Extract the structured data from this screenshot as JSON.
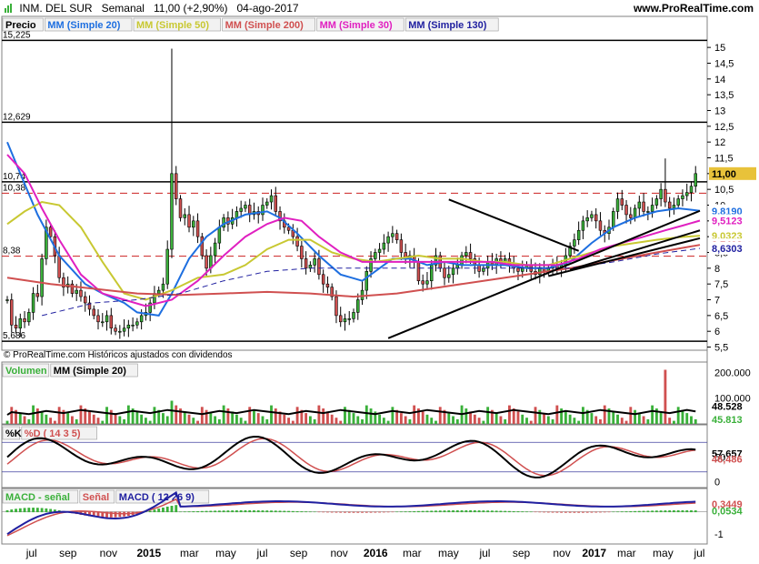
{
  "header": {
    "instrument": "INM. DEL SUR",
    "period": "Semanal",
    "last_change": "11,00 (+2,90%)",
    "date": "04-ago-2017",
    "site": "www.ProRealTime.com"
  },
  "price_panel": {
    "legend": [
      {
        "label": "Precio",
        "color": "#000000"
      },
      {
        "label": "MM (Simple 20)",
        "color": "#1e6fe0"
      },
      {
        "label": "MM (Simple 50)",
        "color": "#c8c832"
      },
      {
        "label": "MM (Simple 200)",
        "color": "#d05050"
      },
      {
        "label": "MM (Simple 30)",
        "color": "#e020c0"
      },
      {
        "label": "MM (Simple 130)",
        "color": "#2020a0"
      }
    ],
    "copyright": "© ProRealTime.com  Históricos ajustados con dividendos",
    "hlines": [
      {
        "label": "15,225",
        "value": 15.225,
        "style": "solid"
      },
      {
        "label": "12,629",
        "value": 12.629,
        "style": "solid"
      },
      {
        "label": "10,74",
        "value": 10.74,
        "style": "solid"
      },
      {
        "label": "10,38",
        "value": 10.38,
        "style": "dashed"
      },
      {
        "label": "8,38",
        "value": 8.38,
        "style": "dashed"
      },
      {
        "label": "5,686",
        "value": 5.686,
        "style": "solid"
      }
    ],
    "badges": [
      {
        "text": "11,00",
        "value": 11.0,
        "bg": "#e8c23a",
        "fg": "#000000"
      },
      {
        "text": "9,8190",
        "value": 9.819,
        "bg": "#ffffff",
        "fg": "#1e6fe0"
      },
      {
        "text": "9,5123",
        "value": 9.5123,
        "bg": "#ffffff",
        "fg": "#e020c0"
      },
      {
        "text": "9,0323",
        "value": 9.0323,
        "bg": "#ffffff",
        "fg": "#c8c832"
      },
      {
        "text": "8,7408",
        "value": 8.7408,
        "bg": "#ffffff",
        "fg": "#d05050"
      },
      {
        "text": "8,6303",
        "value": 8.6303,
        "bg": "#ffffff",
        "fg": "#2020a0"
      }
    ]
  },
  "volume_panel": {
    "legend": [
      {
        "label": "Volumen",
        "color": "#3ab03a"
      },
      {
        "label": "MM (Simple 20)",
        "color": "#000000"
      }
    ],
    "ticks": [
      "200.000",
      "100.000"
    ],
    "badges": [
      {
        "text": "48.528",
        "value": 48528,
        "fg": "#000000"
      },
      {
        "text": "45.813",
        "value": 45813,
        "fg": "#3ab03a"
      }
    ]
  },
  "stoch_panel": {
    "legend": [
      {
        "label": "%K",
        "color": "#000000"
      },
      {
        "label": "%D ( 14 3 5)",
        "color": "#d05050"
      }
    ],
    "ticks": [
      "50",
      "0"
    ],
    "badges": [
      {
        "text": "57,657",
        "value": 57.657,
        "fg": "#000000"
      },
      {
        "text": "46,486",
        "value": 46.486,
        "fg": "#d05050"
      }
    ]
  },
  "macd_panel": {
    "legend": [
      {
        "label": "MACD - señal",
        "color": "#3ab03a"
      },
      {
        "label": "Señal",
        "color": "#d05050"
      },
      {
        "label": "MACD ( 12 26 9)",
        "color": "#2020a0"
      }
    ],
    "ticks": [
      "-1"
    ],
    "badges": [
      {
        "text": "0,3449",
        "value": 0.3449,
        "fg": "#d05050"
      },
      {
        "text": "0,0534",
        "value": 0.0534,
        "fg": "#3ab03a"
      }
    ]
  },
  "x_labels": [
    "jul",
    "sep",
    "nov",
    "2015",
    "mar",
    "may",
    "jul",
    "sep",
    "nov",
    "2016",
    "mar",
    "may",
    "jul",
    "sep",
    "nov",
    "2017",
    "mar",
    "may",
    "jul"
  ],
  "chart_data": {
    "type": "line",
    "price_axis": {
      "ticks": [
        "5,5",
        "6",
        "6,5",
        "7",
        "7,5",
        "8",
        "8,5",
        "9",
        "9,5",
        "10",
        "10,5",
        "11",
        "11,5",
        "12",
        "12,5",
        "13",
        "13,5",
        "14",
        "14,5",
        "15"
      ],
      "ylim": [
        5.4,
        15.35
      ]
    },
    "x_range": [
      0,
      160
    ],
    "x_label_positions": [
      6,
      15,
      25,
      35,
      45,
      54,
      63,
      72,
      82,
      91,
      100,
      109,
      118,
      127,
      137,
      145,
      153,
      162,
      171
    ],
    "price_closes": [
      7.0,
      6.2,
      6.1,
      6.4,
      6.3,
      6.6,
      7.2,
      7.1,
      8.3,
      9.3,
      9.0,
      8.4,
      7.7,
      7.4,
      7.5,
      7.2,
      7.3,
      7.1,
      6.9,
      6.7,
      6.5,
      6.3,
      6.3,
      6.5,
      6.1,
      6.0,
      6.0,
      6.1,
      6.2,
      6.2,
      6.3,
      6.5,
      6.6,
      6.9,
      7.2,
      7.3,
      7.5,
      8.6,
      11.0,
      10.2,
      9.6,
      9.7,
      9.3,
      9.5,
      9.0,
      8.4,
      8.0,
      8.4,
      8.8,
      9.3,
      9.6,
      9.4,
      9.6,
      9.8,
      9.9,
      10.0,
      9.7,
      9.8,
      9.7,
      10.0,
      10.1,
      10.3,
      9.8,
      9.5,
      9.3,
      9.2,
      9.0,
      8.7,
      8.3,
      8.0,
      8.1,
      8.3,
      7.8,
      7.5,
      7.4,
      7.1,
      6.5,
      6.3,
      6.4,
      6.4,
      6.6,
      7.0,
      7.3,
      7.9,
      8.3,
      8.5,
      8.6,
      8.8,
      9.0,
      9.1,
      8.9,
      8.5,
      8.3,
      8.4,
      8.2,
      7.6,
      7.5,
      7.6,
      8.1,
      8.4,
      8.0,
      7.7,
      7.8,
      8.0,
      8.1,
      8.4,
      8.5,
      8.3,
      8.1,
      7.9,
      8.0,
      8.2,
      8.1,
      8.3,
      8.2,
      8.3,
      8.1,
      8.0,
      7.9,
      8.0,
      8.1,
      7.9,
      7.8,
      8.0,
      7.9,
      8.0,
      8.1,
      8.0,
      8.1,
      8.4,
      8.7,
      8.9,
      9.2,
      9.5,
      9.6,
      9.7,
      9.5,
      9.2,
      9.1,
      9.3,
      9.8,
      10.2,
      10.0,
      9.7,
      9.6,
      9.9,
      10.1,
      9.8,
      9.8,
      10.0,
      10.2,
      10.5,
      10.1,
      9.9,
      10.0,
      10.2,
      10.3,
      10.4,
      10.6,
      11.0
    ],
    "series": [
      {
        "name": "MM (Simple 20)",
        "color": "#1e6fe0",
        "values": [
          [
            0,
            12.0
          ],
          [
            3,
            11.0
          ],
          [
            7,
            9.7
          ],
          [
            12,
            8.4
          ],
          [
            18,
            7.5
          ],
          [
            22,
            7.2
          ],
          [
            27,
            6.9
          ],
          [
            30,
            6.6
          ],
          [
            35,
            6.5
          ],
          [
            38,
            7.2
          ],
          [
            42,
            8.3
          ],
          [
            46,
            9.0
          ],
          [
            50,
            9.4
          ],
          [
            55,
            9.7
          ],
          [
            60,
            9.8
          ],
          [
            63,
            9.6
          ],
          [
            67,
            9.1
          ],
          [
            72,
            8.4
          ],
          [
            77,
            7.8
          ],
          [
            82,
            7.6
          ],
          [
            85,
            7.9
          ],
          [
            89,
            8.3
          ],
          [
            93,
            8.3
          ],
          [
            97,
            8.1
          ],
          [
            101,
            8.2
          ],
          [
            105,
            8.1
          ],
          [
            110,
            8.1
          ],
          [
            115,
            8.1
          ],
          [
            120,
            8.0
          ],
          [
            125,
            8.0
          ],
          [
            130,
            8.2
          ],
          [
            135,
            8.8
          ],
          [
            140,
            9.3
          ],
          [
            145,
            9.6
          ],
          [
            150,
            9.8
          ],
          [
            155,
            9.9
          ],
          [
            160,
            9.82
          ]
        ]
      },
      {
        "name": "MM (Simple 50)",
        "color": "#c8c832",
        "values": [
          [
            0,
            9.4
          ],
          [
            4,
            9.8
          ],
          [
            8,
            10.1
          ],
          [
            12,
            10.0
          ],
          [
            17,
            9.3
          ],
          [
            22,
            8.2
          ],
          [
            27,
            7.2
          ],
          [
            32,
            7.0
          ],
          [
            38,
            7.3
          ],
          [
            44,
            7.7
          ],
          [
            50,
            7.8
          ],
          [
            55,
            8.1
          ],
          [
            60,
            8.6
          ],
          [
            65,
            8.9
          ],
          [
            70,
            8.9
          ],
          [
            75,
            8.5
          ],
          [
            80,
            8.3
          ],
          [
            85,
            8.2
          ],
          [
            90,
            8.3
          ],
          [
            95,
            8.4
          ],
          [
            100,
            8.3
          ],
          [
            105,
            8.3
          ],
          [
            110,
            8.2
          ],
          [
            115,
            8.2
          ],
          [
            120,
            8.1
          ],
          [
            125,
            8.1
          ],
          [
            130,
            8.3
          ],
          [
            135,
            8.5
          ],
          [
            140,
            8.7
          ],
          [
            145,
            8.8
          ],
          [
            150,
            8.9
          ],
          [
            155,
            8.98
          ],
          [
            160,
            9.03
          ]
        ]
      },
      {
        "name": "MM (Simple 30)",
        "color": "#e020c0",
        "values": [
          [
            0,
            11.6
          ],
          [
            4,
            11.0
          ],
          [
            8,
            9.9
          ],
          [
            12,
            8.9
          ],
          [
            17,
            7.8
          ],
          [
            22,
            7.2
          ],
          [
            27,
            7.0
          ],
          [
            32,
            6.8
          ],
          [
            38,
            7.0
          ],
          [
            44,
            7.6
          ],
          [
            50,
            8.4
          ],
          [
            55,
            9.0
          ],
          [
            60,
            9.4
          ],
          [
            64,
            9.6
          ],
          [
            68,
            9.5
          ],
          [
            72,
            9.0
          ],
          [
            77,
            8.5
          ],
          [
            82,
            8.2
          ],
          [
            87,
            8.2
          ],
          [
            92,
            8.2
          ],
          [
            97,
            8.2
          ],
          [
            102,
            8.2
          ],
          [
            107,
            8.2
          ],
          [
            112,
            8.2
          ],
          [
            117,
            8.1
          ],
          [
            122,
            8.1
          ],
          [
            127,
            8.1
          ],
          [
            132,
            8.3
          ],
          [
            137,
            8.6
          ],
          [
            142,
            8.8
          ],
          [
            147,
            9.0
          ],
          [
            152,
            9.2
          ],
          [
            156,
            9.35
          ],
          [
            160,
            9.51
          ]
        ]
      },
      {
        "name": "MM (Simple 200)",
        "color": "#d05050",
        "values": [
          [
            0,
            7.7
          ],
          [
            10,
            7.5
          ],
          [
            20,
            7.35
          ],
          [
            30,
            7.2
          ],
          [
            40,
            7.15
          ],
          [
            50,
            7.2
          ],
          [
            60,
            7.25
          ],
          [
            70,
            7.2
          ],
          [
            80,
            7.1
          ],
          [
            90,
            7.2
          ],
          [
            100,
            7.4
          ],
          [
            110,
            7.6
          ],
          [
            120,
            7.8
          ],
          [
            130,
            8.0
          ],
          [
            140,
            8.25
          ],
          [
            150,
            8.5
          ],
          [
            160,
            8.74
          ]
        ]
      },
      {
        "name": "MM (Simple 130)",
        "color": "#2020a0",
        "values": [
          [
            8,
            6.5
          ],
          [
            20,
            6.9
          ],
          [
            30,
            7.0
          ],
          [
            40,
            7.2
          ],
          [
            50,
            7.6
          ],
          [
            60,
            7.9
          ],
          [
            70,
            8.0
          ],
          [
            80,
            8.0
          ],
          [
            90,
            8.0
          ],
          [
            100,
            8.0
          ],
          [
            110,
            8.0
          ],
          [
            120,
            8.0
          ],
          [
            130,
            8.0
          ],
          [
            140,
            8.2
          ],
          [
            150,
            8.45
          ],
          [
            160,
            8.63
          ]
        ]
      }
    ],
    "trendlines": [
      {
        "from": [
          88,
          5.78
        ],
        "to": [
          160,
          9.82
        ]
      },
      {
        "from": [
          102,
          10.18
        ],
        "to": [
          132,
          8.55
        ]
      },
      {
        "from": [
          130,
          7.95
        ],
        "to": [
          160,
          9.2
        ]
      },
      {
        "from": [
          125,
          7.75
        ],
        "to": [
          160,
          8.95
        ]
      }
    ],
    "volume": {
      "ylim": [
        0,
        240000
      ],
      "ma_last": 48528,
      "last": 45813
    },
    "stochastic": {
      "ylim": [
        -10,
        110
      ],
      "k_last": 57.657,
      "d_last": 46.486,
      "levels": [
        20,
        80
      ]
    },
    "macd": {
      "ylim": [
        -1.4,
        1.0
      ],
      "signal_last": 0.3449,
      "hist_last": 0.0534
    }
  }
}
